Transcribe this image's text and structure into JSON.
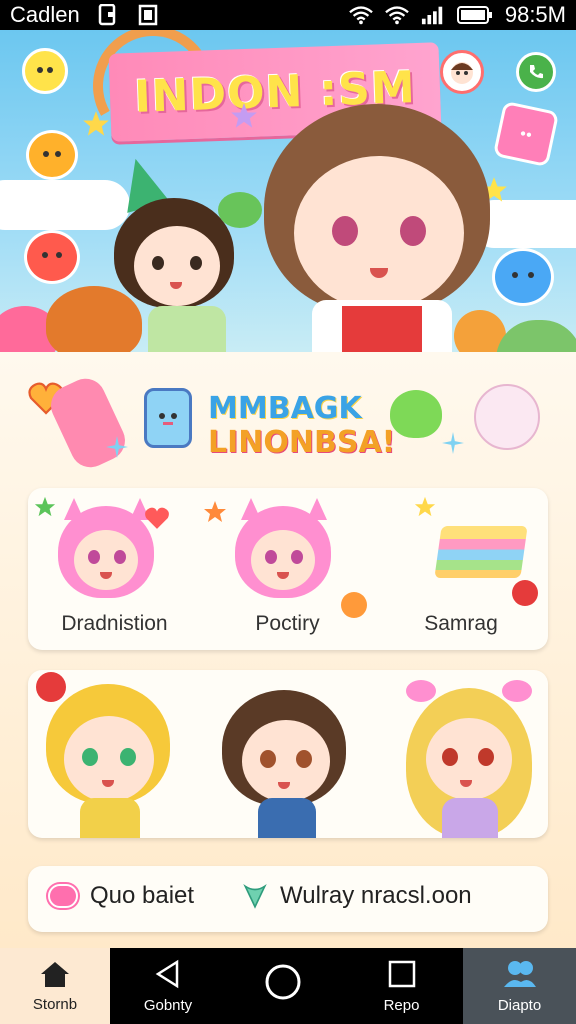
{
  "status_bar": {
    "left_text": "Cadlen",
    "time": "98:5M",
    "icons": [
      "notification-icon",
      "clipboard-icon",
      "wifi-icon",
      "wifi-icon",
      "signal-icon",
      "battery-icon"
    ]
  },
  "banner": {
    "title": "INDON :SM",
    "stickers": [
      "yellow-face-icon",
      "party-hat-icon",
      "shopping-bag-icon",
      "star-icon",
      "blue-blob-icon",
      "red-blob-icon",
      "phone-icon",
      "kid-face-icon"
    ]
  },
  "welcome": {
    "title_line1": "MMBAGK",
    "title_line2": "LINONBSA!"
  },
  "categories": [
    {
      "label": "Dradnistion",
      "icon": "pink-cat-girl-icon"
    },
    {
      "label": "Poctiry",
      "icon": "pink-cat-girl-icon"
    },
    {
      "label": "Samrag",
      "icon": "cake-icon"
    }
  ],
  "characters": [
    {
      "name": "blonde-boy",
      "hair": "#f6c93a",
      "eyes": "#3cb371",
      "shirt": "#f2d049"
    },
    {
      "name": "brown-hair-kid",
      "hair": "#5a3a26",
      "eyes": "#a0522d",
      "shirt": "#3a6db0"
    },
    {
      "name": "blonde-girl-bow",
      "hair": "#f3cf56",
      "eyes": "#c0392b",
      "shirt": "#c9a7e8"
    }
  ],
  "favorites": [
    {
      "label": "Quo baiet",
      "icon": "pink-pill-icon"
    },
    {
      "label": "Wulray nracsl.oon",
      "icon": "green-heart-icon"
    }
  ],
  "bottom_nav": [
    {
      "label": "Stornb",
      "icon": "home-icon"
    },
    {
      "label": "Gobnty",
      "icon": "back-triangle-icon"
    },
    {
      "label": "",
      "icon": "circle-home-icon"
    },
    {
      "label": "Repo",
      "icon": "square-icon"
    },
    {
      "label": "Diapto",
      "icon": "people-icon"
    }
  ],
  "colors": {
    "banner_pink": "#ff8ab8",
    "title_yellow": "#ffe34a",
    "content_bg": "#fff3dd",
    "nav_active": "#fde9d2",
    "nav_last": "#4a5259"
  }
}
